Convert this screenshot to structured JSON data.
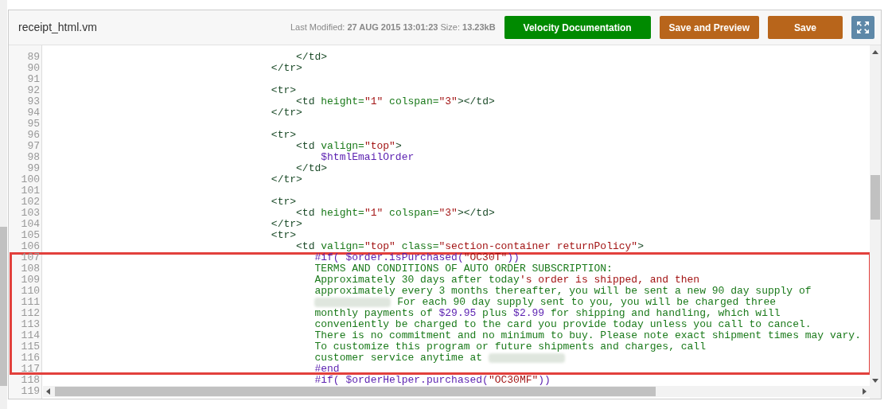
{
  "header": {
    "filename": "receipt_html.vm",
    "meta": "Last Modified: **27 AUG 2015 13:01:23**  Size: **13.23kB**",
    "buttons": [
      {
        "label": "Velocity Documentation",
        "kind": "docs"
      },
      {
        "label": "Save and Preview",
        "kind": "save"
      },
      {
        "label": "Save",
        "kind": "save"
      }
    ]
  },
  "editor": {
    "lines": [
      {
        "number": "89",
        "highlighted": false,
        "tokens": [
          {
            "kind": "tag",
            "text": "                                        </td>"
          }
        ]
      },
      {
        "number": "90",
        "highlighted": false,
        "tokens": [
          {
            "kind": "tag",
            "text": "                                    </tr>"
          }
        ]
      },
      {
        "number": "91",
        "highlighted": false
      },
      {
        "number": "92",
        "highlighted": false,
        "tokens": [
          {
            "kind": "tag",
            "text": "                                    <tr>"
          }
        ]
      },
      {
        "number": "93",
        "highlighted": false,
        "tokens": [
          {
            "kind": "tag",
            "text": "                                        <td"
          },
          {
            "kind": "attr",
            "text": " height="
          },
          {
            "kind": "string",
            "text": "\"1\""
          },
          {
            "kind": "attr",
            "text": " colspan="
          },
          {
            "kind": "string",
            "text": "\"3\""
          },
          {
            "kind": "tag",
            "text": "></td>"
          }
        ]
      },
      {
        "number": "94",
        "highlighted": false,
        "tokens": [
          {
            "kind": "tag",
            "text": "                                    </tr>"
          }
        ]
      },
      {
        "number": "95",
        "highlighted": false
      },
      {
        "number": "96",
        "highlighted": false,
        "tokens": [
          {
            "kind": "tag",
            "text": "                                    <tr>"
          }
        ]
      },
      {
        "number": "97",
        "highlighted": false,
        "tokens": [
          {
            "kind": "tag",
            "text": "                                        <td"
          },
          {
            "kind": "attr",
            "text": " valign="
          },
          {
            "kind": "string",
            "text": "\"top\""
          },
          {
            "kind": "tag",
            "text": ">"
          }
        ]
      },
      {
        "number": "98",
        "highlighted": false,
        "tokens": [
          {
            "kind": "var",
            "text": "                                            $htmlEmailOrder"
          }
        ]
      },
      {
        "number": "99",
        "highlighted": false,
        "tokens": [
          {
            "kind": "tag",
            "text": "                                        </td>"
          }
        ]
      },
      {
        "number": "100",
        "highlighted": false,
        "tokens": [
          {
            "kind": "tag",
            "text": "                                    </tr>"
          }
        ]
      },
      {
        "number": "101",
        "highlighted": false
      },
      {
        "number": "102",
        "highlighted": false,
        "tokens": [
          {
            "kind": "tag",
            "text": "                                    <tr>"
          }
        ]
      },
      {
        "number": "103",
        "highlighted": false,
        "tokens": [
          {
            "kind": "tag",
            "text": "                                        <td"
          },
          {
            "kind": "attr",
            "text": " height="
          },
          {
            "kind": "string",
            "text": "\"1\""
          },
          {
            "kind": "attr",
            "text": " colspan="
          },
          {
            "kind": "string",
            "text": "\"3\""
          },
          {
            "kind": "tag",
            "text": "></td>"
          }
        ]
      },
      {
        "number": "104",
        "highlighted": false,
        "tokens": [
          {
            "kind": "tag",
            "text": "                                    </tr>"
          }
        ]
      },
      {
        "number": "105",
        "highlighted": false,
        "tokens": [
          {
            "kind": "tag",
            "text": "                                    <tr>"
          }
        ]
      },
      {
        "number": "106",
        "highlighted": false,
        "tokens": [
          {
            "kind": "tag",
            "text": "                                        <td"
          },
          {
            "kind": "attr",
            "text": " valign="
          },
          {
            "kind": "string",
            "text": "\"top\""
          },
          {
            "kind": "attr",
            "text": " class="
          },
          {
            "kind": "string",
            "text": "\"section-container returnPolicy\""
          },
          {
            "kind": "tag",
            "text": ">"
          }
        ]
      },
      {
        "number": "107",
        "highlighted": true,
        "tokens": [
          {
            "kind": "var",
            "text": "                                           #if( $order.isPurchased("
          },
          {
            "kind": "string",
            "text": "\"OC30T\""
          },
          {
            "kind": "var",
            "text": "))"
          }
        ]
      },
      {
        "number": "108",
        "highlighted": true,
        "tokens": [
          {
            "kind": "text",
            "text": "                                           TERMS AND CONDITIONS OF AUTO ORDER SUBSCRIPTION:"
          }
        ]
      },
      {
        "number": "109",
        "highlighted": true,
        "tokens": [
          {
            "kind": "text",
            "text": "                                           Approximately 30 days after today"
          },
          {
            "kind": "string",
            "text": "'s order is shipped, and then"
          }
        ]
      },
      {
        "number": "110",
        "highlighted": true,
        "tokens": [
          {
            "kind": "text",
            "text": "                                           approximately every 3 months thereafter, you will be sent a new 90 day supply of"
          }
        ]
      },
      {
        "number": "111",
        "highlighted": true,
        "tokens": [
          {
            "kind": "redacted"
          },
          {
            "kind": "text",
            "text": " For each 90 day supply sent to you, you will be charged three"
          }
        ]
      },
      {
        "number": "112",
        "highlighted": true,
        "tokens": [
          {
            "kind": "text",
            "text": "                                           monthly payments of "
          },
          {
            "kind": "var",
            "text": "$29.95"
          },
          {
            "kind": "text",
            "text": " plus "
          },
          {
            "kind": "var",
            "text": "$2.99"
          },
          {
            "kind": "text",
            "text": " for shipping and handling, which will"
          }
        ]
      },
      {
        "number": "113",
        "highlighted": true,
        "tokens": [
          {
            "kind": "text",
            "text": "                                           conveniently be charged to the card you provide today unless you call to cancel."
          }
        ]
      },
      {
        "number": "114",
        "highlighted": true,
        "tokens": [
          {
            "kind": "text",
            "text": "                                           There is no commitment and no minimum to buy. Please note exact shipment times may vary."
          }
        ]
      },
      {
        "number": "115",
        "highlighted": true,
        "tokens": [
          {
            "kind": "text",
            "text": "                                           To customize this program or future shipments and charges, call"
          }
        ]
      },
      {
        "number": "116",
        "highlighted": true,
        "tokens": [
          {
            "kind": "text",
            "text": "                                           customer service anytime at "
          },
          {
            "kind": "redacted"
          }
        ]
      },
      {
        "number": "117",
        "highlighted": true,
        "tokens": [
          {
            "kind": "var",
            "text": "                                           #end"
          }
        ]
      },
      {
        "number": "118",
        "highlighted": false,
        "tokens": [
          {
            "kind": "var",
            "text": "                                           #if( $orderHelper.purchased("
          },
          {
            "kind": "string",
            "text": "\"OC30MF\""
          },
          {
            "kind": "var",
            "text": "))"
          }
        ]
      },
      {
        "number": "119",
        "highlighted": false
      }
    ]
  }
}
